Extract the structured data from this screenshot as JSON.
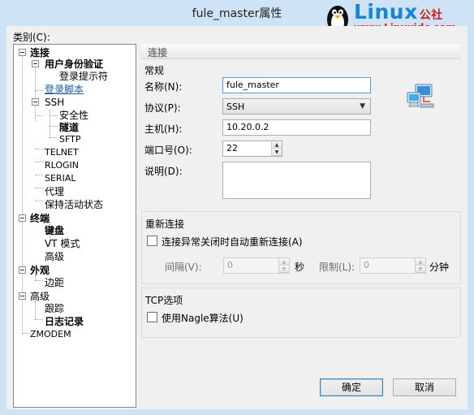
{
  "window": {
    "title": "fule_master属性"
  },
  "watermark": {
    "brand": "Linux",
    "brand_suffix": "公社",
    "url": "www.Linuxidc.com"
  },
  "category_label": "类别(C):",
  "tree": {
    "connection": "连接",
    "user_auth": "用户身份验证",
    "login_prompt": "登录提示符",
    "login_script": "登录脚本",
    "ssh": "SSH",
    "security": "安全性",
    "tunnel": "隧道",
    "sftp": "SFTP",
    "telnet": "TELNET",
    "rlogin": "RLOGIN",
    "serial": "SERIAL",
    "proxy": "代理",
    "keepalive": "保持活动状态",
    "terminal": "终端",
    "keyboard": "键盘",
    "vt_mode": "VT 模式",
    "advanced_term": "高级",
    "appearance": "外观",
    "margin": "边距",
    "advanced": "高级",
    "trace": "跟踪",
    "logging": "日志记录",
    "zmodem": "ZMODEM"
  },
  "panel": {
    "header": "连接",
    "general": {
      "title": "常规",
      "name_label": "名称(N):",
      "name_value": "fule_master",
      "protocol_label": "协议(P):",
      "protocol_value": "SSH",
      "host_label": "主机(H):",
      "host_value": "10.20.0.2",
      "port_label": "端口号(O):",
      "port_value": "22",
      "desc_label": "说明(D):",
      "desc_value": ""
    },
    "reconnect": {
      "title": "重新连接",
      "auto_label": "连接异常关闭时自动重新连接(A)",
      "auto_checked": false,
      "interval_label": "间隔(V):",
      "interval_value": "0",
      "interval_unit": "秒",
      "limit_label": "限制(L):",
      "limit_value": "0",
      "limit_unit": "分钟"
    },
    "tcp": {
      "title": "TCP选项",
      "nagle_label": "使用Nagle算法(U)",
      "nagle_checked": false
    }
  },
  "buttons": {
    "ok": "确定",
    "cancel": "取消"
  }
}
